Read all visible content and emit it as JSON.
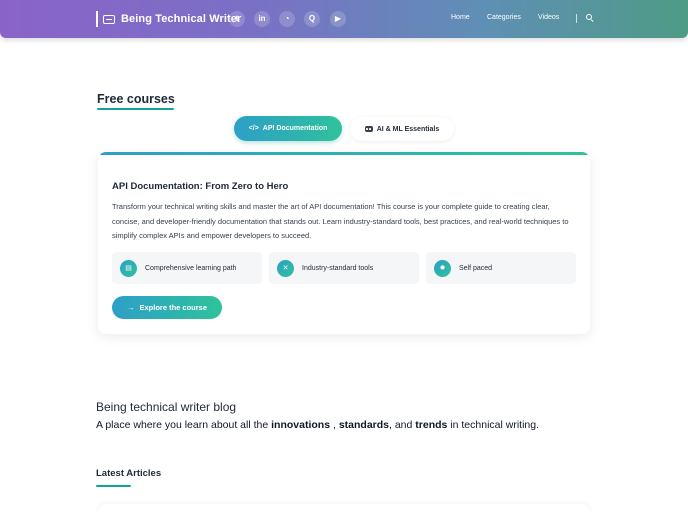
{
  "header": {
    "brand": "Being Technical Writer",
    "social": [
      {
        "name": "twitter-icon",
        "glyph": "t"
      },
      {
        "name": "linkedin-icon",
        "glyph": "in"
      },
      {
        "name": "github-icon",
        "glyph": "◔"
      },
      {
        "name": "quora-icon",
        "glyph": "Q"
      },
      {
        "name": "youtube-icon",
        "glyph": "▶"
      }
    ],
    "nav": [
      "Home",
      "Categories",
      "Videos"
    ]
  },
  "courses": {
    "section_title": "Free courses",
    "tabs": [
      {
        "label": "API Documentation",
        "icon": "code-icon",
        "active": true
      },
      {
        "label": "AI & ML Essentials",
        "icon": "robot-icon",
        "active": false
      }
    ],
    "card": {
      "title": "API Documentation: From Zero to Hero",
      "description": "Transform your technical writing skills and master the art of API documentation! This course is your complete guide to creating clear, concise, and developer-friendly documentation that stands out. Learn industry-standard tools, best practices, and real-world techniques to simplify complex APIs and empower developers to succeed.",
      "features": [
        {
          "label": "Comprehensive learning path",
          "icon": "book-icon",
          "glyph": "▤"
        },
        {
          "label": "Industry-standard tools",
          "icon": "tools-icon",
          "glyph": "✕"
        },
        {
          "label": "Self paced",
          "icon": "gear-icon",
          "glyph": "✹"
        }
      ],
      "cta_label": "Explore the course"
    }
  },
  "blog": {
    "title": "Being technical writer blog",
    "subtitle_parts": {
      "p1": "A place where you learn about all the ",
      "b1": "innovations",
      "p2": " , ",
      "b2": "standards",
      "p3": ", and ",
      "b3": "trends",
      "p4": " in technical writing."
    },
    "latest_title": "Latest Articles"
  },
  "colors": {
    "accent_start": "#2d9fc8",
    "accent_end": "#2fc29a",
    "underline": "#14a39a"
  }
}
